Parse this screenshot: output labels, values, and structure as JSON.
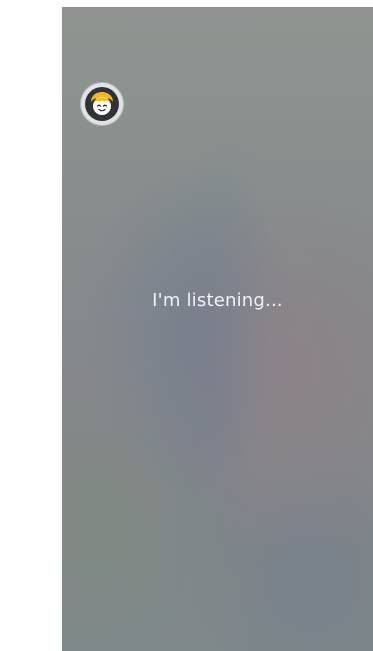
{
  "assistant": {
    "status_text": "I'm listening..."
  },
  "colors": {
    "background_page": "#ffffff",
    "screen_base": "#8b928f",
    "text": "#f2f2f2",
    "avatar_face": "#f5b51d",
    "avatar_bg": "#2f3338"
  },
  "icons": {
    "avatar": "child-face-icon"
  }
}
